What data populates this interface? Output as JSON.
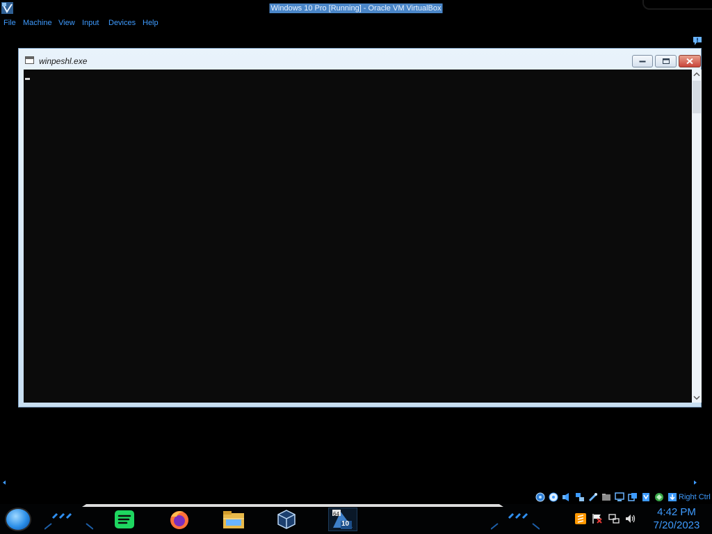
{
  "host": {
    "title": "Windows 10 Pro [Running] - Oracle VM VirtualBox",
    "menu": [
      {
        "label": "File"
      },
      {
        "label": "Machine"
      },
      {
        "label": "View"
      },
      {
        "label": "Input"
      },
      {
        "label": "Devices"
      },
      {
        "label": "Help"
      }
    ],
    "host_key": "Right Ctrl",
    "status_icons": [
      "hard-disk-icon",
      "optical-drive-icon",
      "audio-icon",
      "network-icon",
      "usb-icon",
      "shared-folders-icon",
      "display-icon",
      "recording-icon",
      "capture-icon",
      "keyboard-icon",
      "mouse-integration-icon",
      "host-key-arrow-icon"
    ]
  },
  "guest_window": {
    "title": "winpeshl.exe"
  },
  "taskbar": {
    "pinned": [
      "spotify-icon",
      "firefox-icon",
      "file-explorer-icon",
      "virtualbox-icon",
      "windows10-vm-icon"
    ],
    "vm_badge_top": "64",
    "vm_badge_bottom": "10",
    "tray": [
      "sublime-text-icon",
      "action-center-flag-icon",
      "network-tray-icon",
      "volume-icon"
    ],
    "time": "4:42 PM",
    "date": "7/20/2023"
  },
  "colors": {
    "accent_blue": "#3e9bff",
    "title_highlight": "#4a86c8",
    "console_bg": "#0b0b0b"
  }
}
